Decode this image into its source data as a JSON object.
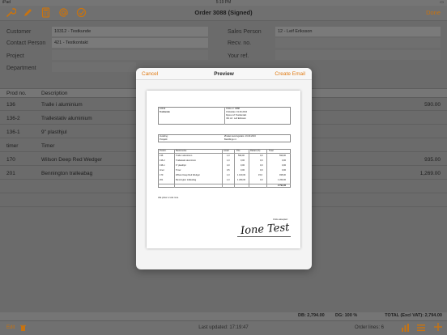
{
  "status_bar": {
    "left": "iPad",
    "time": "5:19 PM",
    "battery": "▭"
  },
  "nav": {
    "title": "Order 3088 (Signed)",
    "done_label": "Done",
    "icons": [
      "wrench-icon",
      "pencil-icon",
      "calculator-icon",
      "at-icon",
      "checkmark-circle-icon"
    ]
  },
  "header_fields": {
    "customer_label": "Customer",
    "customer_value": "10312 - Testkunde",
    "contact_label": "Contact Person",
    "contact_value": "421 - Testkontakt",
    "project_label": "Project",
    "department_label": "Department",
    "sales_person_label": "Sales Person",
    "sales_person_value": "12 - Leif Eriksson",
    "recv_no_label": "Recv. no.",
    "your_ref_label": "Your ref."
  },
  "table": {
    "headers": {
      "prod_no": "Prod no.",
      "description": "Description"
    },
    "rows": [
      {
        "prod_no": "136",
        "description": "Tralle i aluminium",
        "amount": "590.00"
      },
      {
        "prod_no": "136-2",
        "description": "Trallestativ aluminium",
        "amount": ""
      },
      {
        "prod_no": "136-1",
        "description": "9\" plasthjul",
        "amount": ""
      },
      {
        "prod_no": "timer",
        "description": "Timer",
        "amount": ""
      },
      {
        "prod_no": "170",
        "description": "Wilson Deep Red Wedger",
        "amount": "935.00"
      },
      {
        "prod_no": "201",
        "description": "Bennington tralleabag",
        "amount": "1,269.00"
      }
    ]
  },
  "totals": {
    "db": "DB: 2,794.00",
    "dg": "DG: 100 %",
    "total": "TOTAL (Excl VAT): 2,794.00"
  },
  "toolbar": {
    "edit_label": "Edit",
    "last_updated": "Last updated: 17:19:47",
    "order_lines": "Order lines: 6"
  },
  "modal": {
    "cancel_label": "Cancel",
    "title": "Preview",
    "email_label": "Create Email",
    "document": {
      "customer_no": "10312",
      "customer_name": "Testkunde",
      "order_no": "Ordre nr: 3088",
      "order_date": "Ordredato: 19.09.2016",
      "your_ref": "Deres ref: Testkontakt",
      "our_ref": "Vår ref.: Leif Eriksson",
      "delivery_label": "Avdeling:",
      "project_label": "Prosjekt:",
      "delivery_date": "Ønsket leveringsdato: 19.09.2016",
      "order_ref": "Bestillings nr.",
      "col_headers": [
        "Prodnr.",
        "Beskrivelse",
        "Antall",
        "Pris",
        "Rabatt (%)",
        "Total"
      ],
      "lines": [
        [
          "136",
          "Tralle i aluminium",
          "1,0",
          "590,00",
          "0,0",
          "590,00"
        ],
        [
          "136-2",
          "Trallestativ aluminium",
          "1,0",
          "0,00",
          "0,0",
          "0,00"
        ],
        [
          "136-1",
          "9\" plasthjul",
          "4,0",
          "0,00",
          "0,0",
          "0,00"
        ],
        [
          "timer",
          "Timer",
          "0,5",
          "0,00",
          "0,0",
          "0,00"
        ],
        [
          "170",
          "Wilson Deep Red Wedger",
          "1,0",
          "1 100,00",
          "15,0",
          "935,00"
        ],
        [
          "201",
          "Bennington tralleabag",
          "1,0",
          "1 269,00",
          "0,0",
          "1 269,00"
        ]
      ],
      "sum": "2 794,00",
      "note": "Alle priser er eks mva.",
      "accepted": "Ordre akseptert:",
      "signature": "Ione Test"
    }
  },
  "colors": {
    "accent": "#c8730f",
    "email_accent": "#e07a12",
    "dim_bg": "#6b6b6b"
  }
}
